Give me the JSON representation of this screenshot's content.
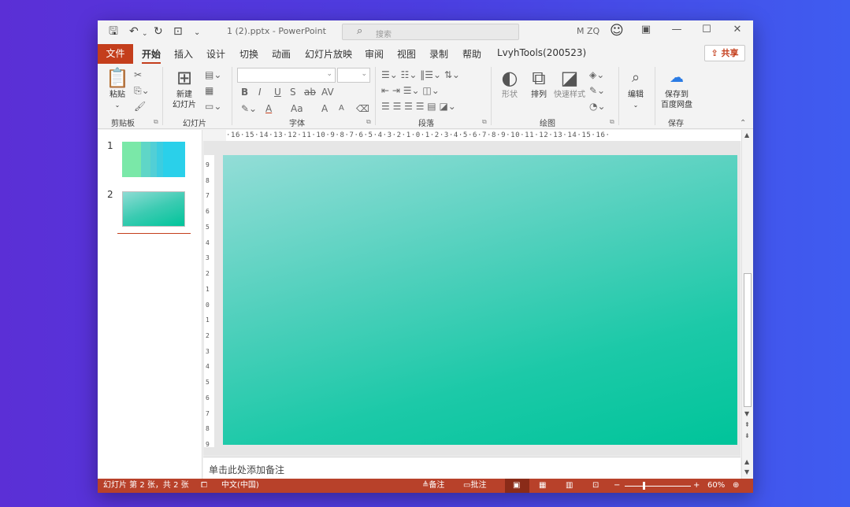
{
  "titlebar": {
    "filename": "1 (2).pptx  -  PowerPoint",
    "search_placeholder": "搜索",
    "user": "M ZQ",
    "icons": [
      "save-icon",
      "undo-icon",
      "redo-icon",
      "present-icon",
      "customize-icon"
    ]
  },
  "menu": {
    "file": "文件",
    "tabs": [
      "开始",
      "插入",
      "设计",
      "切换",
      "动画",
      "幻灯片放映",
      "审阅",
      "视图",
      "录制",
      "帮助",
      "LvyhTools(200523)"
    ],
    "active_tab": "开始",
    "share": "共享"
  },
  "ribbon": {
    "paste": "粘贴",
    "new_slide_1": "新建",
    "new_slide_2": "幻灯片",
    "shapes": "形状",
    "arrange": "排列",
    "quick_styles": "快速样式",
    "edit": "编辑",
    "save_baidu_1": "保存到",
    "save_baidu_2": "百度网盘",
    "groups": {
      "clipboard": "剪贴板",
      "slides": "幻灯片",
      "font": "字体",
      "paragraph": "段落",
      "drawing": "绘图",
      "save": "保存"
    },
    "font_bold": "B",
    "font_italic": "I",
    "font_underline": "U",
    "font_shadow": "S",
    "font_strike": "ab",
    "font_spacing": "AV",
    "font_color": "A",
    "font_case": "Aa",
    "font_grow": "A",
    "font_shrink": "A"
  },
  "thumbnails": [
    {
      "num": "1"
    },
    {
      "num": "2"
    }
  ],
  "ruler": {
    "horizontal": "·16·15·14·13·12·11·10·9·8·7·6·5·4·3·2·1·0·1·2·3·4·5·6·7·8·9·10·11·12·13·14·15·16·",
    "vertical": [
      "9",
      "8",
      "7",
      "6",
      "5",
      "4",
      "3",
      "2",
      "1",
      "0",
      "1",
      "2",
      "3",
      "4",
      "5",
      "6",
      "7",
      "8",
      "9"
    ]
  },
  "notes": {
    "placeholder": "单击此处添加备注"
  },
  "status": {
    "slide_info": "幻灯片 第 2 张，共 2 张",
    "language": "中文(中国)",
    "notes_btn": "备注",
    "comments_btn": "批注",
    "zoom": "60%"
  },
  "colors": {
    "accent": "#c43e1c",
    "status_bar": "#b8412a",
    "slide_gradient_start": "#93ddd7",
    "slide_gradient_end": "#00c49a"
  }
}
